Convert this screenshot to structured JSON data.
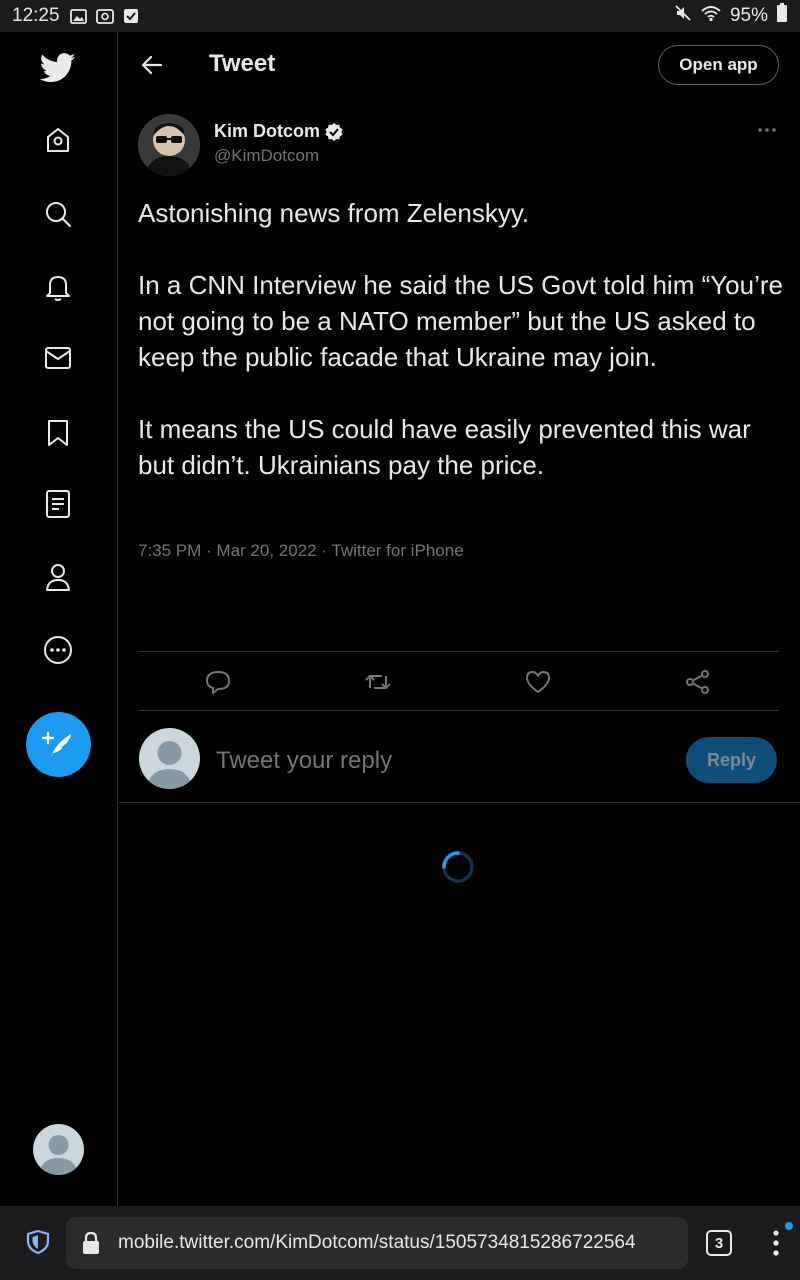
{
  "status_bar": {
    "time": "12:25",
    "battery": "95%",
    "icons": [
      "image-icon",
      "screenshot-icon",
      "checkbox-icon",
      "mute-icon",
      "wifi-icon",
      "battery-icon"
    ]
  },
  "sidebar": {
    "items": [
      {
        "name": "twitter-logo-icon"
      },
      {
        "name": "home-icon"
      },
      {
        "name": "search-icon"
      },
      {
        "name": "notifications-bell-icon"
      },
      {
        "name": "messages-mail-icon"
      },
      {
        "name": "bookmarks-icon"
      },
      {
        "name": "lists-icon"
      },
      {
        "name": "profile-icon"
      },
      {
        "name": "more-icon"
      }
    ],
    "compose_icon": "feather-plus-icon"
  },
  "header": {
    "title": "Tweet",
    "open_app_label": "Open app"
  },
  "tweet": {
    "author_name": "Kim Dotcom",
    "handle": "@KimDotcom",
    "verified": true,
    "paragraphs": [
      "Astonishing news from Zelenskyy.",
      "In a CNN Interview he said the US Govt told him “You’re not going to be a NATO member” but the US asked to keep the public facade that Ukraine may join.",
      "It means the US could have easily prevented this war but didn’t. Ukrainians pay the price."
    ],
    "meta": "7:35 PM · Mar 20, 2022 · Twitter for iPhone"
  },
  "reply": {
    "placeholder": "Tweet your reply",
    "button_label": "Reply"
  },
  "browser": {
    "url": "mobile.twitter.com/KimDotcom/status/1505734815286722564",
    "tab_count": "3"
  },
  "colors": {
    "accent": "#1d9bf0",
    "background": "#000000",
    "border": "#2f3336",
    "secondary_text": "#71767b"
  }
}
